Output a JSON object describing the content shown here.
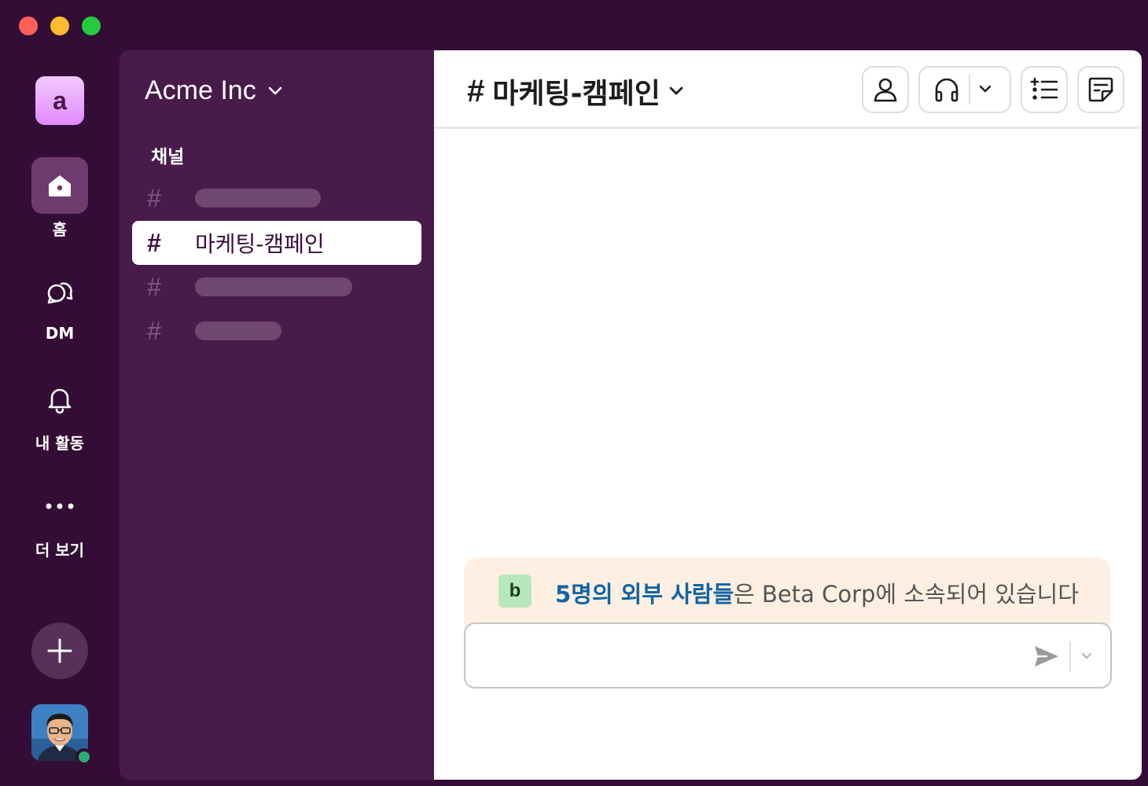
{
  "rail": {
    "workspace_initial": "a",
    "items": [
      {
        "label": "홈",
        "icon": "home-icon"
      },
      {
        "label": "DM",
        "icon": "dm-icon"
      },
      {
        "label": "내 활동",
        "icon": "bell-icon"
      },
      {
        "label": "더 보기",
        "icon": "more-icon"
      }
    ],
    "add_icon": "plus-icon",
    "presence_color": "#2bac76"
  },
  "sidebar": {
    "workspace_name": "Acme Inc",
    "section_title": "채널",
    "active_channel": "마케팅-캠페인"
  },
  "main": {
    "channel_title": "마케팅-캠페인",
    "external_banner": {
      "badge": "b",
      "link_text": "5명의 외부 사람들",
      "rest_text": "은 Beta Corp에 소속되어 있습니다"
    }
  },
  "colors": {
    "background": "#330d35",
    "sidebar": "#481b4a",
    "link": "#1264a3",
    "banner": "#fdf0e2"
  }
}
